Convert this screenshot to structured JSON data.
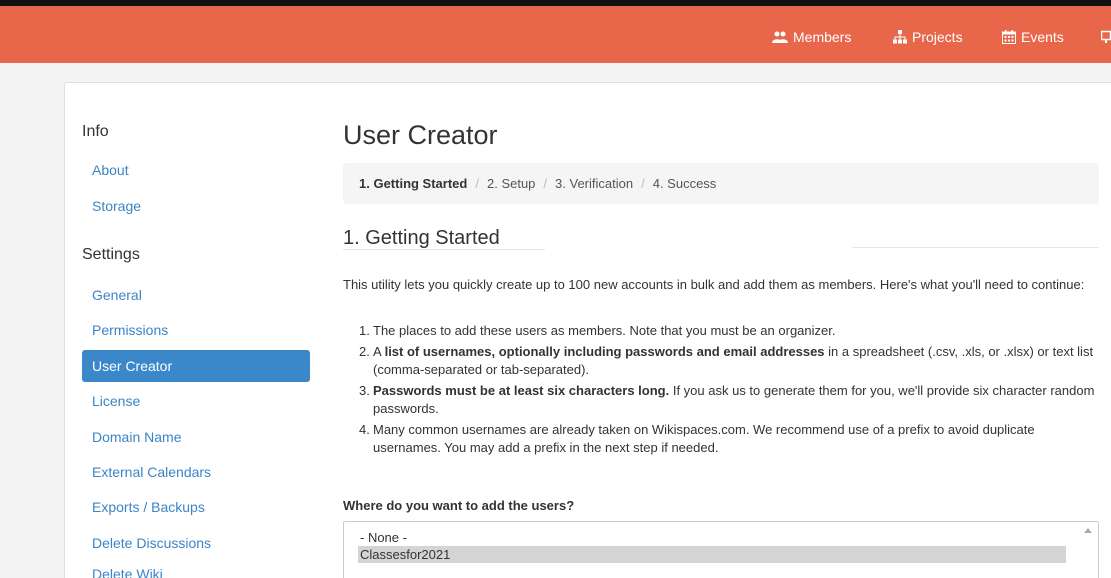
{
  "topnav": {
    "members": "Members",
    "projects": "Projects",
    "events": "Events"
  },
  "sidebar": {
    "info_heading": "Info",
    "info_items": [
      "About",
      "Storage"
    ],
    "settings_heading": "Settings",
    "settings_items": [
      "General",
      "Permissions",
      "User Creator",
      "License",
      "Domain Name",
      "External Calendars",
      "Exports / Backups",
      "Delete Discussions",
      "Delete Wiki"
    ],
    "active_item": "User Creator"
  },
  "main": {
    "title": "User Creator",
    "breadcrumb": [
      "1. Getting Started",
      "2. Setup",
      "3. Verification",
      "4. Success"
    ],
    "breadcrumb_separator": "/",
    "section_title": "1. Getting Started",
    "intro": "This utility lets you quickly create up to 100 new accounts in bulk and add them as members. Here's what you'll need to continue:",
    "requirements": [
      {
        "num": "1.",
        "bold": "",
        "text": "The places to add these users as members. Note that you must be an organizer."
      },
      {
        "num": "2.",
        "pre": "A ",
        "bold": "list of usernames, optionally including passwords and email addresses",
        "text": " in a spreadsheet (.csv, .xls, or .xlsx) or text list (comma-separated or tab-separated)."
      },
      {
        "num": "3.",
        "pre": "",
        "bold": "Passwords must be at least six characters long.",
        "text": " If you ask us to generate them for you, we'll provide six character random passwords."
      },
      {
        "num": "4.",
        "bold": "",
        "text": "Many common usernames are already taken on Wikispaces.com. We recommend use of a prefix to avoid duplicate usernames. You may add a prefix in the next step if needed."
      }
    ],
    "where_label": "Where do you want to add the users?",
    "select_options": [
      "- None -",
      "Classesfor2021"
    ],
    "selected_option": "Classesfor2021"
  },
  "colors": {
    "topbar": "#e8664a",
    "link": "#3b85c6",
    "active": "#3a87c9"
  }
}
